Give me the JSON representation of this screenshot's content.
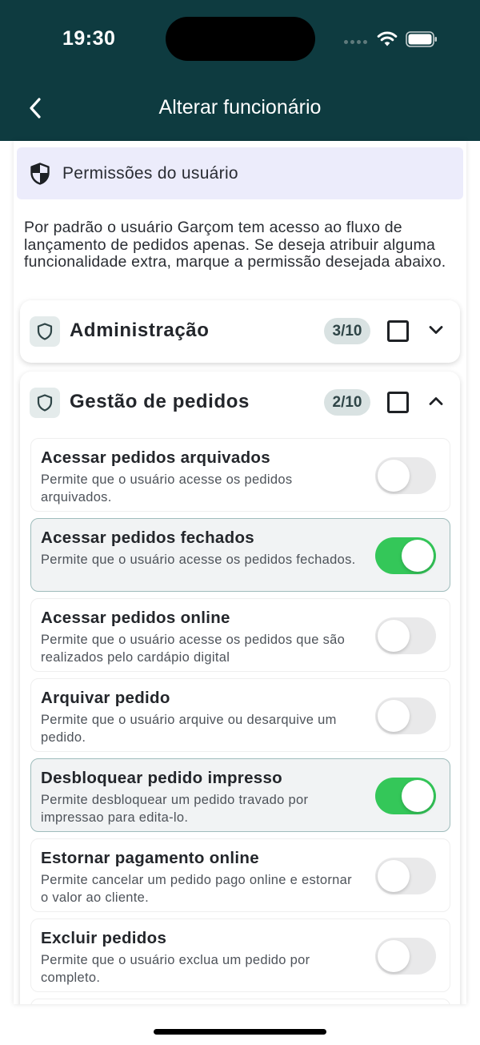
{
  "status_bar": {
    "time": "19:30"
  },
  "header": {
    "title": "Alterar funcionário",
    "back_icon": "chevron-left-icon"
  },
  "permissions": {
    "banner_title": "Permissões do usuário",
    "intro": "Por padrão o usuário Garçom tem acesso ao fluxo de lançamento de pedidos apenas. Se deseja atribuir alguma funcionalidade extra, marque a permissão desejada abaixo."
  },
  "groups": [
    {
      "title": "Administração",
      "count": "3/10",
      "checked": false,
      "expanded": false
    },
    {
      "title": "Gestão de pedidos",
      "count": "2/10",
      "checked": false,
      "expanded": true
    }
  ],
  "items": [
    {
      "title": "Acessar pedidos arquivados",
      "desc": "Permite que o usuário acesse os pedidos arquivados.",
      "enabled": false
    },
    {
      "title": "Acessar pedidos fechados",
      "desc": "Permite que o usuário acesse os pedidos fechados.",
      "enabled": true
    },
    {
      "title": "Acessar pedidos online",
      "desc": "Permite que o usuário acesse os pedidos que são realizados pelo cardápio digital",
      "enabled": false
    },
    {
      "title": "Arquivar pedido",
      "desc": "Permite que o usuário arquive ou desarquive um pedido.",
      "enabled": false
    },
    {
      "title": "Desbloquear pedido impresso",
      "desc": "Permite desbloquear um pedido travado por impressao para edita-lo.",
      "enabled": true
    },
    {
      "title": "Estornar pagamento online",
      "desc": "Permite cancelar um pedido pago online e estornar o valor ao cliente.",
      "enabled": false
    },
    {
      "title": "Excluir pedidos",
      "desc": "Permite que o usuário exclua um pedido por completo.",
      "enabled": false
    }
  ],
  "colors": {
    "header_bg": "#0e3b40",
    "banner_bg": "#ececfb",
    "toggle_on": "#34c759",
    "toggle_off": "#e9e9ea"
  }
}
